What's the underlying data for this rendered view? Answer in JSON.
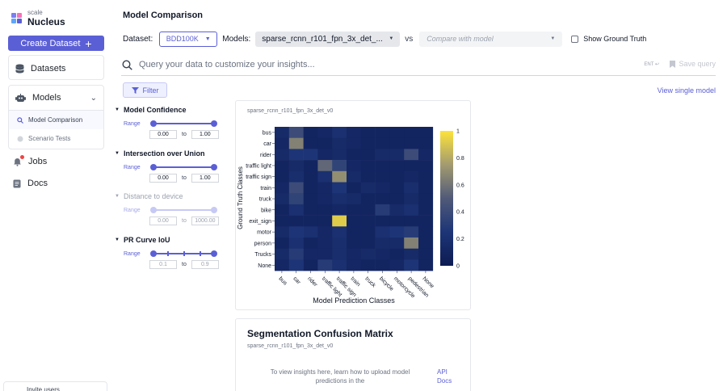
{
  "app": {
    "logo_scale": "scale",
    "logo_name": "Nucleus"
  },
  "sidebar": {
    "create_label": "Create Dataset",
    "datasets_label": "Datasets",
    "models_label": "Models",
    "model_comparison_label": "Model Comparison",
    "scenario_tests_label": "Scenario Tests",
    "jobs_label": "Jobs",
    "docs_label": "Docs",
    "invite_label": "Invite users"
  },
  "header": {
    "title": "Model Comparison",
    "dataset_label": "Dataset:",
    "dataset_value": "BDD100K",
    "models_label": "Models:",
    "model_value": "sparse_rcnn_r101_fpn_3x_det_...",
    "vs_label": "vs",
    "compare_placeholder": "Compare with model",
    "show_ground_truth": "Show Ground Truth"
  },
  "search": {
    "placeholder": "Query your data to customize your insights...",
    "enter_hint": "ENT ↩",
    "save_label": "Save query"
  },
  "filter_label": "Filter",
  "view_single_label": "View single model",
  "filters": [
    {
      "name": "Model Confidence",
      "range_label": "Range",
      "min": "0.00",
      "max": "1.00",
      "low": 0.0,
      "high": 1.0,
      "to": "to"
    },
    {
      "name": "Intersection over Union",
      "range_label": "Range",
      "min": "0.00",
      "max": "1.00",
      "low": 0.0,
      "high": 1.0,
      "to": "to"
    },
    {
      "name": "Distance to device",
      "range_label": "Range",
      "min": "0.00",
      "max": "1000.00",
      "low": 0.0,
      "high": 1.0,
      "to": "to"
    },
    {
      "name": "PR Curve IoU",
      "range_label": "Range",
      "min": "0.1",
      "max": "0.9",
      "low": 0.0,
      "high": 1.0,
      "to": "to"
    }
  ],
  "chart_card": {
    "subtitle": "sparse_rcnn_r101_fpn_3x_det_v0"
  },
  "seg_card": {
    "title": "Segmentation Confusion Matrix",
    "subtitle": "sparse_rcnn_r101_fpn_3x_det_v0",
    "empty_message": "To view insights here, learn how to upload model predictions in the",
    "link_label": "API Docs"
  },
  "colors": {
    "accent": "#5b5fd6",
    "heat_low": "#0d1b52",
    "heat_high": "#fde33a"
  },
  "chart_data": {
    "type": "heatmap",
    "xlabel": "Model Prediction Classes",
    "ylabel": "Ground Truth Classes",
    "x_categories": [
      "bus",
      "car",
      "rider",
      "traffic light",
      "traffic sign",
      "train",
      "truck",
      "bicycle",
      "motorcycle",
      "pedestrian",
      "None"
    ],
    "y_categories": [
      "bus",
      "car",
      "rider",
      "traffic light",
      "traffic sign",
      "train",
      "truck",
      "bike",
      "exit_sign",
      "motor",
      "person",
      "Trucks",
      "None"
    ],
    "colorbar_range": [
      0,
      1
    ],
    "colorbar_ticks": [
      "1",
      "0.8",
      "0.6",
      "0.4",
      "0.2",
      "0"
    ],
    "values": [
      [
        0.15,
        0.4,
        0.1,
        0.12,
        0.2,
        0.12,
        0.1,
        0.1,
        0.1,
        0.1,
        0.1
      ],
      [
        0.12,
        0.65,
        0.1,
        0.1,
        0.15,
        0.12,
        0.1,
        0.1,
        0.1,
        0.1,
        0.1
      ],
      [
        0.15,
        0.25,
        0.25,
        0.12,
        0.15,
        0.1,
        0.1,
        0.15,
        0.15,
        0.4,
        0.12
      ],
      [
        0.1,
        0.15,
        0.1,
        0.55,
        0.35,
        0.12,
        0.1,
        0.1,
        0.1,
        0.1,
        0.1
      ],
      [
        0.1,
        0.18,
        0.1,
        0.2,
        0.7,
        0.15,
        0.1,
        0.1,
        0.1,
        0.12,
        0.1
      ],
      [
        0.12,
        0.4,
        0.1,
        0.12,
        0.25,
        0.1,
        0.15,
        0.12,
        0.1,
        0.18,
        0.1
      ],
      [
        0.15,
        0.35,
        0.1,
        0.12,
        0.18,
        0.15,
        0.1,
        0.1,
        0.1,
        0.15,
        0.1
      ],
      [
        0.1,
        0.2,
        0.1,
        0.1,
        0.12,
        0.1,
        0.1,
        0.3,
        0.15,
        0.2,
        0.1
      ],
      [
        0.1,
        0.1,
        0.1,
        0.1,
        0.92,
        0.1,
        0.1,
        0.1,
        0.1,
        0.1,
        0.1
      ],
      [
        0.15,
        0.25,
        0.2,
        0.12,
        0.2,
        0.1,
        0.1,
        0.2,
        0.25,
        0.3,
        0.1
      ],
      [
        0.1,
        0.2,
        0.1,
        0.12,
        0.18,
        0.1,
        0.1,
        0.15,
        0.15,
        0.65,
        0.1
      ],
      [
        0.15,
        0.3,
        0.12,
        0.12,
        0.18,
        0.12,
        0.15,
        0.12,
        0.1,
        0.15,
        0.1
      ],
      [
        0.12,
        0.25,
        0.1,
        0.3,
        0.2,
        0.12,
        0.1,
        0.1,
        0.12,
        0.25,
        0.1
      ]
    ]
  }
}
